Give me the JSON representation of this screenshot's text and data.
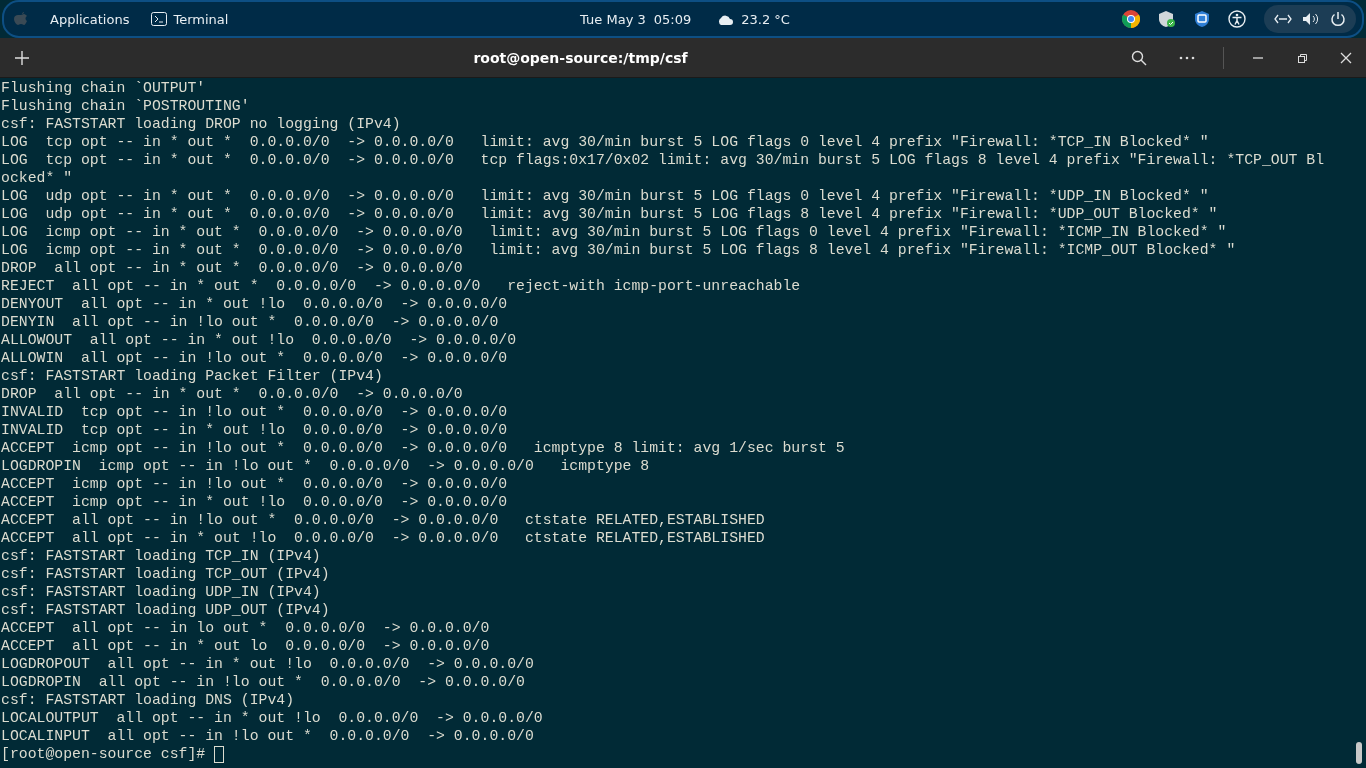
{
  "top_bar": {
    "apps_menu": "Applications",
    "active_app": "Terminal",
    "date": "Tue May 3",
    "time": "05:09",
    "weather": "23.2 °C"
  },
  "window": {
    "title": "root@open-source:/tmp/csf"
  },
  "terminal": {
    "lines": [
      "Flushing chain `OUTPUT'",
      "Flushing chain `POSTROUTING'",
      "csf: FASTSTART loading DROP no logging (IPv4)",
      "LOG  tcp opt -- in * out *  0.0.0.0/0  -> 0.0.0.0/0   limit: avg 30/min burst 5 LOG flags 0 level 4 prefix \"Firewall: *TCP_IN Blocked* \"",
      "LOG  tcp opt -- in * out *  0.0.0.0/0  -> 0.0.0.0/0   tcp flags:0x17/0x02 limit: avg 30/min burst 5 LOG flags 8 level 4 prefix \"Firewall: *TCP_OUT Bl",
      "ocked* \"",
      "LOG  udp opt -- in * out *  0.0.0.0/0  -> 0.0.0.0/0   limit: avg 30/min burst 5 LOG flags 0 level 4 prefix \"Firewall: *UDP_IN Blocked* \"",
      "LOG  udp opt -- in * out *  0.0.0.0/0  -> 0.0.0.0/0   limit: avg 30/min burst 5 LOG flags 8 level 4 prefix \"Firewall: *UDP_OUT Blocked* \"",
      "LOG  icmp opt -- in * out *  0.0.0.0/0  -> 0.0.0.0/0   limit: avg 30/min burst 5 LOG flags 0 level 4 prefix \"Firewall: *ICMP_IN Blocked* \"",
      "LOG  icmp opt -- in * out *  0.0.0.0/0  -> 0.0.0.0/0   limit: avg 30/min burst 5 LOG flags 8 level 4 prefix \"Firewall: *ICMP_OUT Blocked* \"",
      "DROP  all opt -- in * out *  0.0.0.0/0  -> 0.0.0.0/0",
      "REJECT  all opt -- in * out *  0.0.0.0/0  -> 0.0.0.0/0   reject-with icmp-port-unreachable",
      "DENYOUT  all opt -- in * out !lo  0.0.0.0/0  -> 0.0.0.0/0",
      "DENYIN  all opt -- in !lo out *  0.0.0.0/0  -> 0.0.0.0/0",
      "ALLOWOUT  all opt -- in * out !lo  0.0.0.0/0  -> 0.0.0.0/0",
      "ALLOWIN  all opt -- in !lo out *  0.0.0.0/0  -> 0.0.0.0/0",
      "csf: FASTSTART loading Packet Filter (IPv4)",
      "DROP  all opt -- in * out *  0.0.0.0/0  -> 0.0.0.0/0",
      "INVALID  tcp opt -- in !lo out *  0.0.0.0/0  -> 0.0.0.0/0",
      "INVALID  tcp opt -- in * out !lo  0.0.0.0/0  -> 0.0.0.0/0",
      "ACCEPT  icmp opt -- in !lo out *  0.0.0.0/0  -> 0.0.0.0/0   icmptype 8 limit: avg 1/sec burst 5",
      "LOGDROPIN  icmp opt -- in !lo out *  0.0.0.0/0  -> 0.0.0.0/0   icmptype 8",
      "ACCEPT  icmp opt -- in !lo out *  0.0.0.0/0  -> 0.0.0.0/0",
      "ACCEPT  icmp opt -- in * out !lo  0.0.0.0/0  -> 0.0.0.0/0",
      "ACCEPT  all opt -- in !lo out *  0.0.0.0/0  -> 0.0.0.0/0   ctstate RELATED,ESTABLISHED",
      "ACCEPT  all opt -- in * out !lo  0.0.0.0/0  -> 0.0.0.0/0   ctstate RELATED,ESTABLISHED",
      "csf: FASTSTART loading TCP_IN (IPv4)",
      "csf: FASTSTART loading TCP_OUT (IPv4)",
      "csf: FASTSTART loading UDP_IN (IPv4)",
      "csf: FASTSTART loading UDP_OUT (IPv4)",
      "ACCEPT  all opt -- in lo out *  0.0.0.0/0  -> 0.0.0.0/0",
      "ACCEPT  all opt -- in * out lo  0.0.0.0/0  -> 0.0.0.0/0",
      "LOGDROPOUT  all opt -- in * out !lo  0.0.0.0/0  -> 0.0.0.0/0",
      "LOGDROPIN  all opt -- in !lo out *  0.0.0.0/0  -> 0.0.0.0/0",
      "csf: FASTSTART loading DNS (IPv4)",
      "LOCALOUTPUT  all opt -- in * out !lo  0.0.0.0/0  -> 0.0.0.0/0",
      "LOCALINPUT  all opt -- in !lo out *  0.0.0.0/0  -> 0.0.0.0/0"
    ],
    "prompt": "[root@open-source csf]#"
  }
}
